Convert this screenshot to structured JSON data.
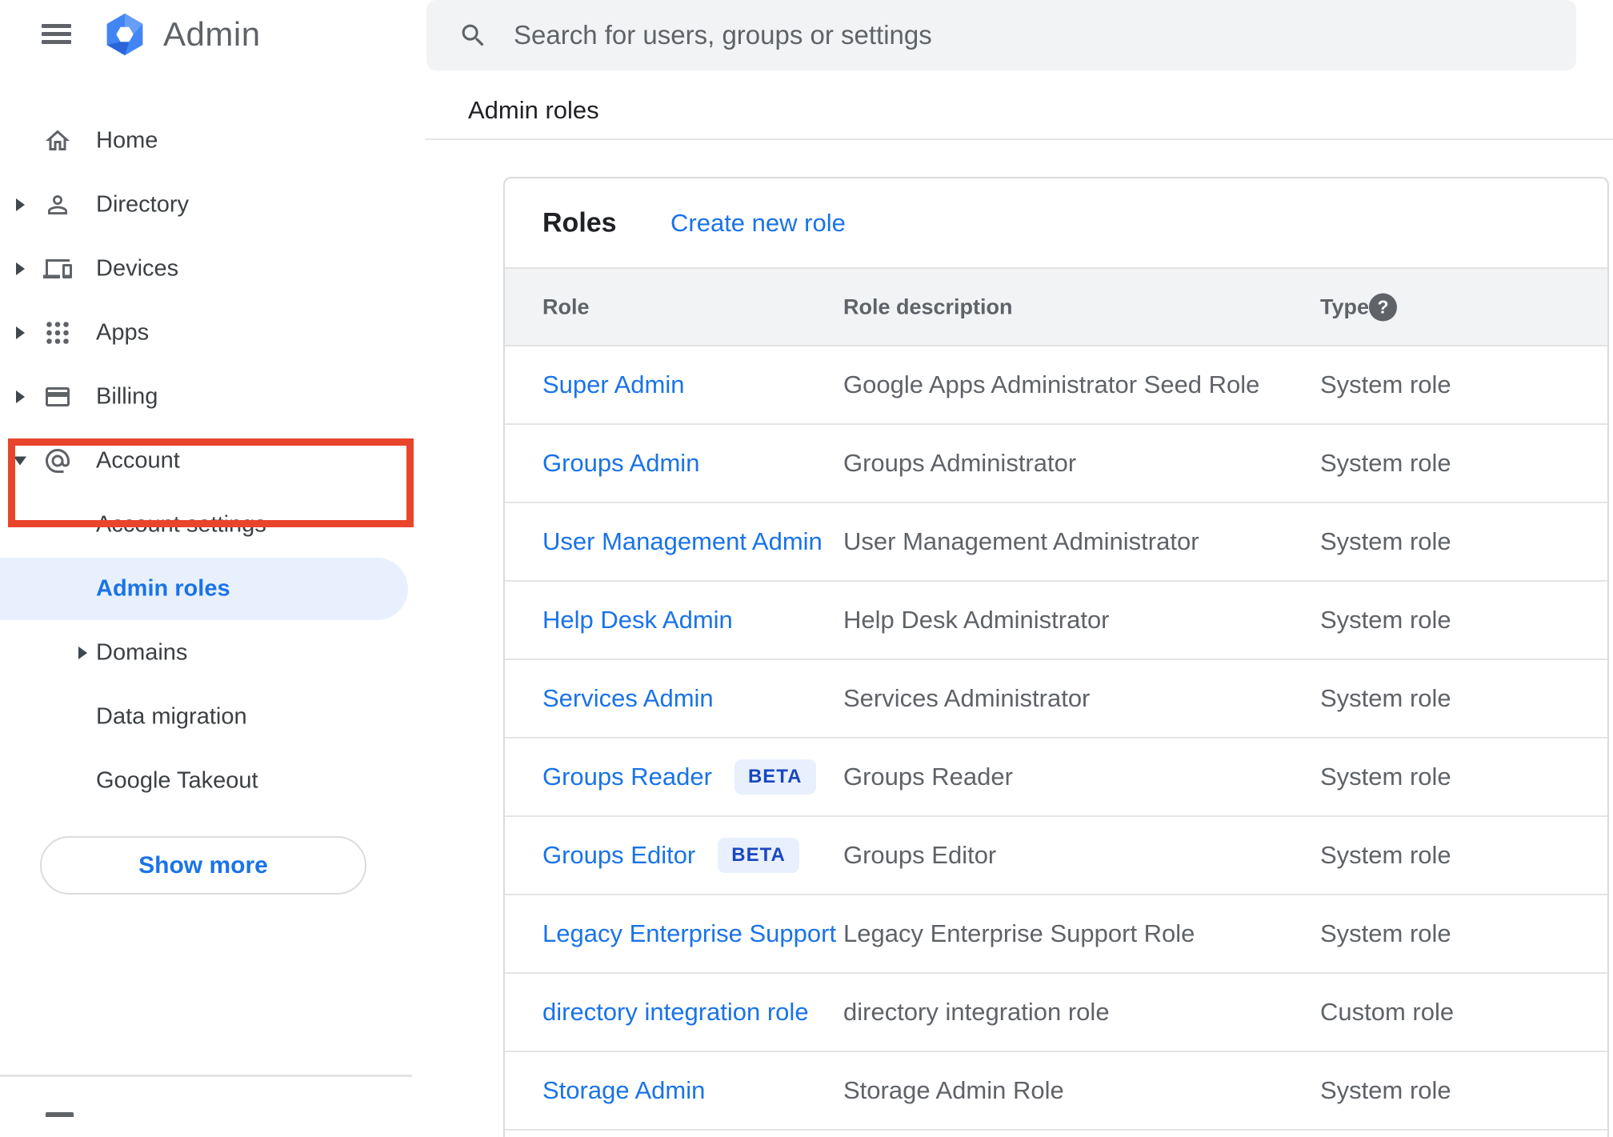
{
  "app": {
    "logo_text": "Admin"
  },
  "search": {
    "placeholder": "Search for users, groups or settings"
  },
  "breadcrumb": {
    "label": "Admin roles"
  },
  "sidebar": {
    "items": [
      {
        "label": "Home",
        "icon": "home-icon"
      },
      {
        "label": "Directory",
        "icon": "person-icon"
      },
      {
        "label": "Devices",
        "icon": "devices-icon"
      },
      {
        "label": "Apps",
        "icon": "apps-grid-icon"
      },
      {
        "label": "Billing",
        "icon": "credit-card-icon"
      },
      {
        "label": "Account",
        "icon": "at-sign-icon"
      },
      {
        "label": "Account settings"
      },
      {
        "label": "Admin roles"
      },
      {
        "label": "Domains"
      },
      {
        "label": "Data migration"
      },
      {
        "label": "Google Takeout"
      }
    ],
    "selected_item": "Admin roles",
    "show_more": "Show more"
  },
  "main": {
    "panel_title": "Roles",
    "create_link": "Create new role",
    "table": {
      "columns": [
        "Role",
        "Role description",
        "Type"
      ],
      "rows": [
        {
          "role": "Super Admin",
          "description": "Google Apps Administrator Seed Role",
          "type": "System role"
        },
        {
          "role": "Groups Admin",
          "description": "Groups Administrator",
          "type": "System role"
        },
        {
          "role": "User Management Admin",
          "description": "User Management Administrator",
          "type": "System role"
        },
        {
          "role": "Help Desk Admin",
          "description": "Help Desk Administrator",
          "type": "System role"
        },
        {
          "role": "Services Admin",
          "description": "Services Administrator",
          "type": "System role"
        },
        {
          "role": "Groups Reader",
          "beta_label": "BETA",
          "description": "Groups Reader",
          "type": "System role"
        },
        {
          "role": "Groups Editor",
          "beta_label": "BETA",
          "description": "Groups Editor",
          "type": "System role"
        },
        {
          "role": "Legacy Enterprise Support",
          "description": "Legacy Enterprise Support Role",
          "type": "System role"
        },
        {
          "role": "directory integration role",
          "description": "directory integration role",
          "type": "Custom role"
        },
        {
          "role": "Storage Admin",
          "description": "Storage Admin Role",
          "type": "System role"
        }
      ]
    }
  },
  "colors": {
    "accent_blue": "#1a73e8",
    "selected_bg": "#e8f0fe",
    "annotation_red": "#e8452c",
    "beta_text": "#1a46c0",
    "header_bg": "#f1f3f4",
    "text_primary": "#202124",
    "text_secondary": "#5f6368"
  }
}
